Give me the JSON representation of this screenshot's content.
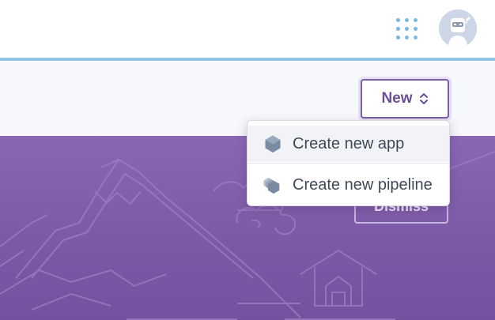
{
  "header": {
    "apps_icon": "apps-grid-icon",
    "avatar_icon": "user-avatar-icon",
    "accent_color": "#93c3e2"
  },
  "toolbar": {
    "new_label": "New",
    "new_icon": "chevron-up-down-icon"
  },
  "dropdown": {
    "items": [
      {
        "label": "Create new app",
        "icon": "hexagon-app-icon"
      },
      {
        "label": "Create new pipeline",
        "icon": "pipeline-stack-icon"
      }
    ]
  },
  "banner": {
    "dismiss_label": "Dismiss",
    "background_color": "#7d5aa6"
  }
}
